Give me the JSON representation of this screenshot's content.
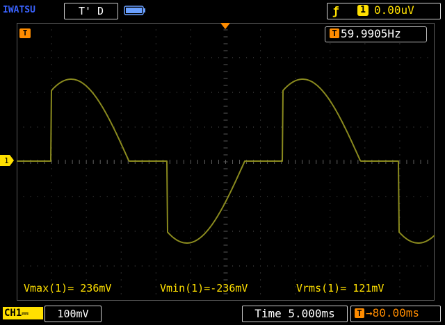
{
  "header": {
    "brand": "IWATSU",
    "trigger_status": "T' D",
    "trigger_source": "1",
    "trigger_level": "0.00uV"
  },
  "readouts": {
    "frequency": "59.9905Hz",
    "measurements": [
      {
        "text": "Vmax(1)= 236mV"
      },
      {
        "text": "Vmin(1)=-236mV"
      },
      {
        "text": "Vrms(1)= 121mV"
      }
    ]
  },
  "footer": {
    "channel": "CH1",
    "volts_div": "100mV",
    "time_base": "Time 5.000ms",
    "trigger_delay": "→80.00ms"
  },
  "markers": {
    "trigger": "T",
    "channel": "1"
  },
  "colors": {
    "trace": "#8a8a1e",
    "channel_yellow": "#ffe000",
    "trigger_orange": "#ff8c00",
    "brand_blue": "#3a63ff",
    "grid": "#5a5a5a"
  },
  "icons": {
    "battery": "battery-icon",
    "edge": "rising-edge-icon"
  }
}
